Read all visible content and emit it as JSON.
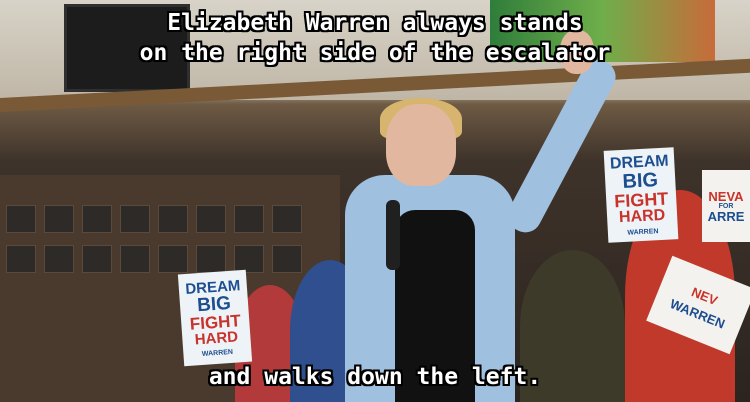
{
  "caption": {
    "top_lines": [
      "Elizabeth Warren always stands",
      "on the right side of the escalator"
    ],
    "bottom_line": "and walks down the left."
  },
  "signs": {
    "left": {
      "lines": [
        "DREAM",
        "BIG",
        "FIGHT",
        "HARD"
      ],
      "brand": "WARREN"
    },
    "right": {
      "lines": [
        "DREAM",
        "BIG",
        "FIGHT",
        "HARD"
      ],
      "brand": "WARREN"
    },
    "far_right": {
      "lines": [
        "NEVA",
        "FOR",
        "ARRE"
      ]
    },
    "bottom_right": {
      "lines": [
        "NEV",
        "WARREN"
      ]
    }
  },
  "colors": {
    "caption_text": "#ffffff",
    "caption_outline": "#000000",
    "sign_blue": "#1d4e8f",
    "sign_red": "#c8332b",
    "jacket": "#9fc0df"
  }
}
